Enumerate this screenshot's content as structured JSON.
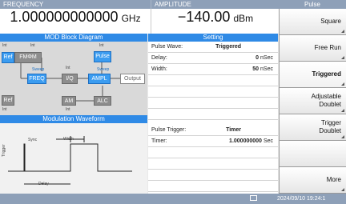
{
  "header": {
    "frequency_label": "FREQUENCY",
    "amplitude_label": "AMPLITUDE",
    "menu_title": "Pulse"
  },
  "frequency": {
    "value": "1.000000000000",
    "unit": "GHz"
  },
  "amplitude": {
    "value": "−140.00",
    "unit": "dBm"
  },
  "mod_diagram": {
    "title": "MOD Block Diagram",
    "blocks": {
      "ref": "Ref",
      "fm": "FMΦM",
      "pulse": "Pulse",
      "freq": "FREQ",
      "iq": "I/Q",
      "ampl": "AMPL",
      "output": "Output",
      "ref2": "Ref",
      "am": "AM",
      "alc": "ALC"
    },
    "small": {
      "int1": "Int",
      "int2": "Int",
      "int3": "Int",
      "int4": "Int",
      "int5": "Int",
      "int6": "Int",
      "sweep1": "Sweep",
      "sweep2": "Sweep"
    }
  },
  "waveform": {
    "title": "Modulation Waveform",
    "sync": "Sync",
    "width": "Width",
    "trigger": "Trigger",
    "delay": "Delay"
  },
  "setting": {
    "title": "Setting",
    "pulse_wave_label": "Pulse Wave:",
    "pulse_wave_value": "Triggered",
    "delay_label": "Delay:",
    "delay_value": "0",
    "delay_unit": "nSec",
    "width_label": "Width:",
    "width_value": "50",
    "width_unit": "nSec",
    "pulse_trigger_label": "Pulse Trigger:",
    "pulse_trigger_value": "Timer",
    "timer_label": "Timer:",
    "timer_value": "1.000000000",
    "timer_unit": "Sec"
  },
  "softkeys": {
    "square": "Square",
    "free_run": "Free Run",
    "triggered": "Triggered",
    "adjustable_1": "Adjustable",
    "adjustable_2": "Doublet",
    "trigger_1": "Trigger",
    "trigger_2": "Doublet",
    "more": "More"
  },
  "status": {
    "datetime": "2024/09/10 19:24:1"
  },
  "colors": {
    "header": "#8ea0b8",
    "panel_title": "#2f8ae6",
    "block_blue": "#3b9cf0",
    "block_gray": "#8d8d8d"
  }
}
